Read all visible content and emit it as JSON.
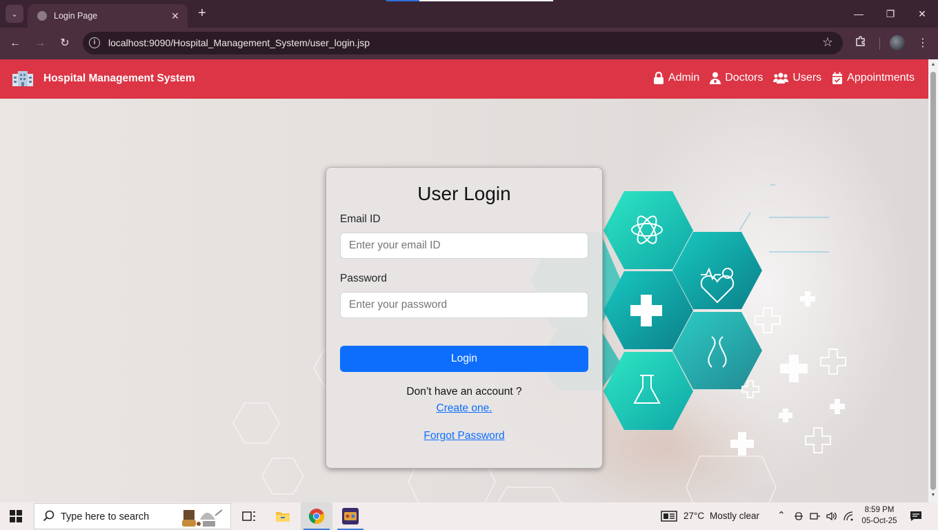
{
  "browser": {
    "tab_title": "Login Page",
    "new_tab_label": "+",
    "url": "localhost:9090/Hospital_Management_System/user_login.jsp",
    "icons": [
      "tab-search-icon",
      "close-icon",
      "back-arrow-icon",
      "forward-arrow-icon",
      "reload-icon",
      "site-info-icon",
      "star-icon",
      "extensions-icon",
      "profile-avatar",
      "kebab-menu-icon",
      "minimize-icon",
      "maximize-icon",
      "window-close-icon"
    ]
  },
  "navbar": {
    "brand": "Hospital Management System",
    "links": [
      {
        "label": "Admin",
        "icon": "lock-icon"
      },
      {
        "label": "Doctors",
        "icon": "user-doctor-icon"
      },
      {
        "label": "Users",
        "icon": "users-icon"
      },
      {
        "label": "Appointments",
        "icon": "calendar-check-icon"
      }
    ],
    "color": "#dc3545"
  },
  "login_form": {
    "title": "User Login",
    "email_label": "Email ID",
    "email_placeholder": "Enter your email ID",
    "email_value": "",
    "password_label": "Password",
    "password_placeholder": "Enter your password",
    "password_value": "",
    "submit_label": "Login",
    "no_account_text": "Don’t have an account ?",
    "create_link": "Create one.",
    "forgot_link": "Forgot Password",
    "button_color": "#0d6efd"
  },
  "taskbar": {
    "search_placeholder": "Type here to search",
    "weather": "27°C",
    "weather_desc": "Mostly clear",
    "time": "8:59 PM",
    "date": "05-Oct-25",
    "apps": [
      "task-view-icon",
      "file-explorer-icon",
      "chrome-icon",
      "game-app-icon"
    ]
  }
}
